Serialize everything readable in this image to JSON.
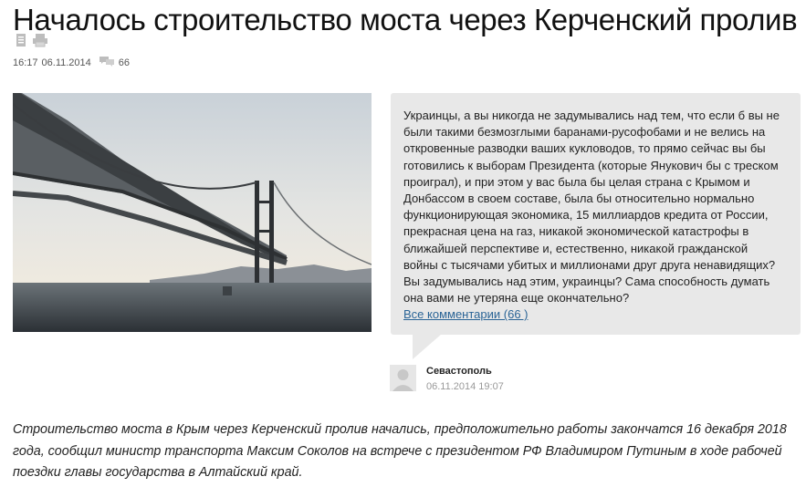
{
  "article": {
    "title": "Началось строительство моста через Керченский пролив",
    "time": "16:17",
    "date": "06.11.2014",
    "comments_count": "66",
    "lead": "Строительство моста в Крым через Керченский пролив начались, предположительно работы закончатся 16 декабря 2018 года, сообщил министр транспорта Максим Соколов на встрече с президентом РФ Владимиром Путиным в ходе рабочей поездки главы государства в Алтайский край."
  },
  "toolbar": {
    "icons": [
      "document-icon",
      "print-icon"
    ]
  },
  "comment": {
    "text": "Украинцы, а вы никогда не задумывались над тем, что если б вы не были такими безмозглыми баранами-русофобами и не велись на откровенные разводки ваших кукловодов, то прямо сейчас вы бы готовились к выборам Президента (которые Янукович бы с треском проиграл), и при этом у вас была бы целая страна с Крымом и Донбассом в своем составе, была бы относительно нормально функционирующая экономика, 15 миллиардов кредита от России, прекрасная цена на газ, никакой экономической катастрофы в ближайшей перспективе и, естественно, никакой гражданской войны с тысячами убитых и миллионами друг друга ненавидящих? Вы задумывались над этим, украинцы? Сама способность думать она вами не утеряна еще окончательно?",
    "all_link": "Все комментарии (66 )",
    "author": "Севастополь",
    "datetime": "06.11.2014 19:07"
  },
  "colors": {
    "bubble_bg": "#e8e8e8",
    "link": "#2a6496",
    "meta_text": "#555555"
  }
}
